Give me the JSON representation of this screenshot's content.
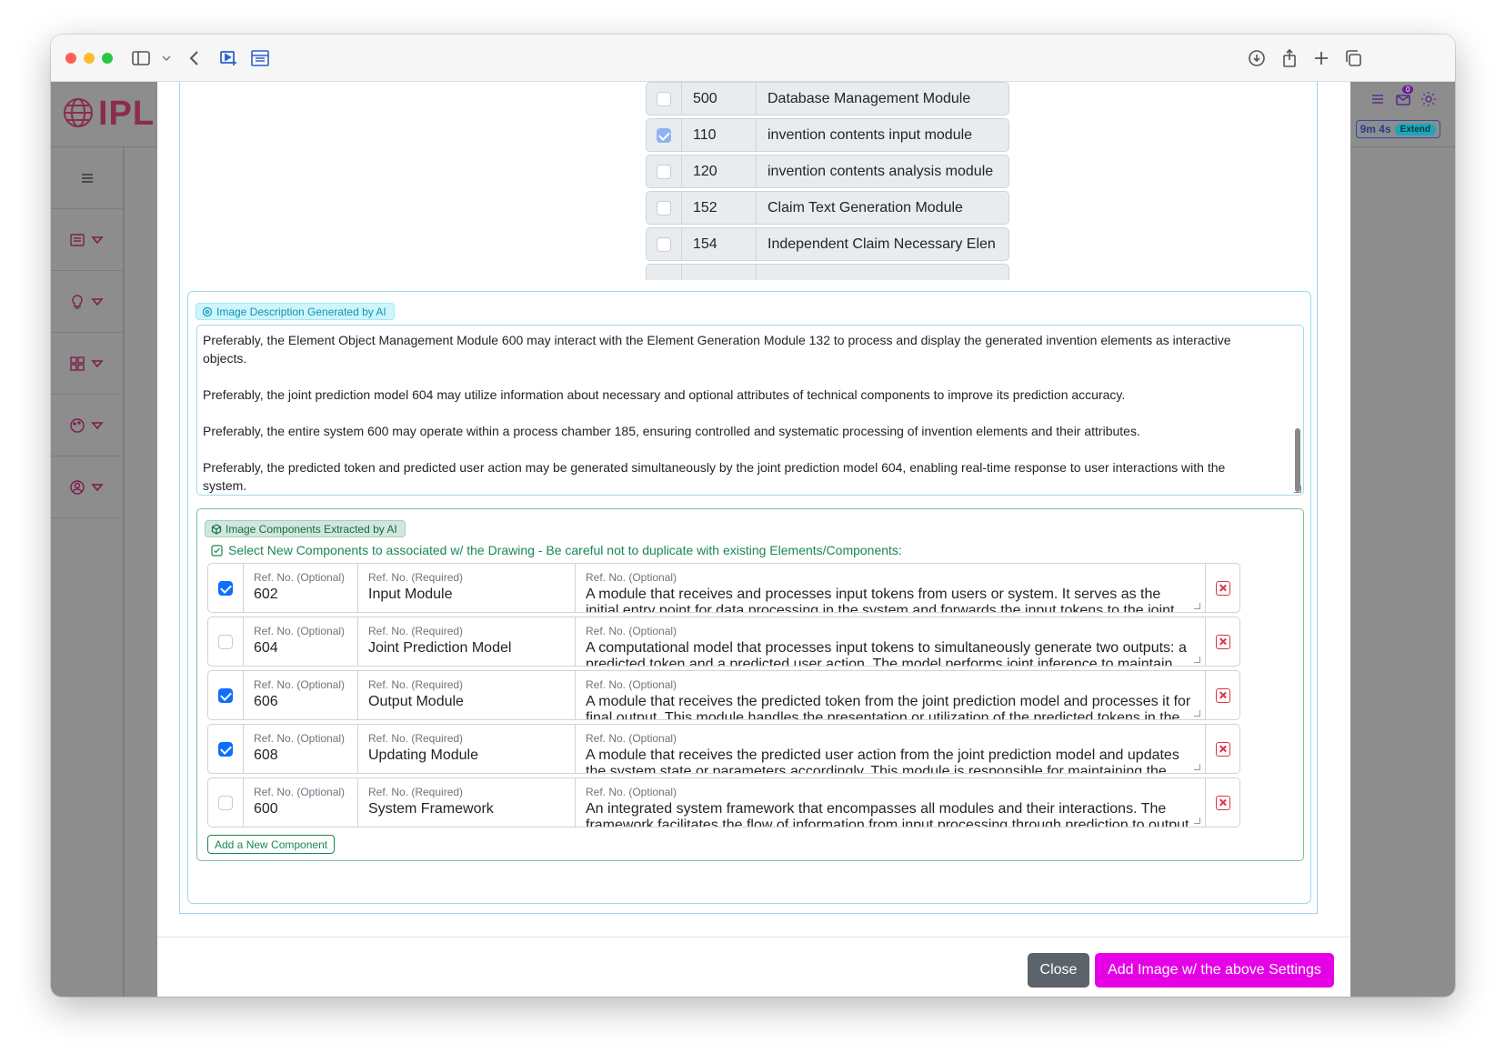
{
  "browser": {
    "traffic_lights": [
      "#ff5f57",
      "#febc2e",
      "#28c840"
    ]
  },
  "app": {
    "logo_text": "IPL",
    "timer_text": "9m 4s",
    "extend_label": "Extend",
    "notification_count": "0",
    "brand_color": "#8a2d4c"
  },
  "elements": [
    {
      "num": "500",
      "name": "Database Management Module",
      "checked": false
    },
    {
      "num": "110",
      "name": "invention contents input module",
      "checked": true
    },
    {
      "num": "120",
      "name": "invention contents analysis module",
      "checked": false
    },
    {
      "num": "152",
      "name": "Claim Text Generation Module",
      "checked": false
    },
    {
      "num": "154",
      "name": "Independent Claim Necessary Elen",
      "checked": false
    }
  ],
  "description": {
    "badge": "Image Description Generated by AI",
    "paragraphs": [
      "Preferably, the Element Object Management Module 600 may interact with the Element Generation Module 132 to process and display the generated invention elements as interactive objects.",
      "Preferably, the joint prediction model 604 may utilize information about necessary and optional attributes of technical components to improve its prediction accuracy.",
      "Preferably, the entire system 600 may operate within a process chamber 185, ensuring controlled and systematic processing of invention elements and their attributes.",
      "Preferably, the predicted token and predicted user action may be generated simultaneously by the joint prediction model 604, enabling real-time response to user interactions with the system."
    ]
  },
  "components": {
    "badge": "Image Components Extracted by AI",
    "hint": "Select New Components to associated w/ the Drawing - Be careful not to duplicate with existing Elements/Components:",
    "label_ref_optional": "Ref. No. (Optional)",
    "label_ref_required": "Ref. No. (Required)",
    "label_desc": "Ref. No. (Optional)",
    "rows": [
      {
        "ref": "602",
        "name": "Input Module",
        "desc": "A module that receives and processes input tokens from users or system. It serves as the initial entry point for data processing in the system and forwards the input tokens to the joint prediction",
        "checked": true
      },
      {
        "ref": "604",
        "name": "Joint Prediction Model",
        "desc": "A computational model that processes input tokens to simultaneously generate two outputs: a predicted token and a predicted user action. The model performs joint inference to maintain",
        "checked": false
      },
      {
        "ref": "606",
        "name": "Output Module",
        "desc": "A module that receives the predicted token from the joint prediction model and processes it for final output. This module handles the presentation or utilization of the predicted tokens in the",
        "checked": true
      },
      {
        "ref": "608",
        "name": "Updating Module",
        "desc": "A module that receives the predicted user action from the joint prediction model and updates the system state or parameters accordingly. This module is responsible for maintaining the dynamic",
        "checked": true
      },
      {
        "ref": "600",
        "name": "System Framework",
        "desc": "An integrated system framework that encompasses all modules and their interactions. The framework facilitates the flow of information from input processing through prediction to output",
        "checked": false
      }
    ],
    "add_label": "Add a New Component"
  },
  "footer": {
    "close_label": "Close",
    "add_image_label": "Add Image w/ the above Settings"
  }
}
